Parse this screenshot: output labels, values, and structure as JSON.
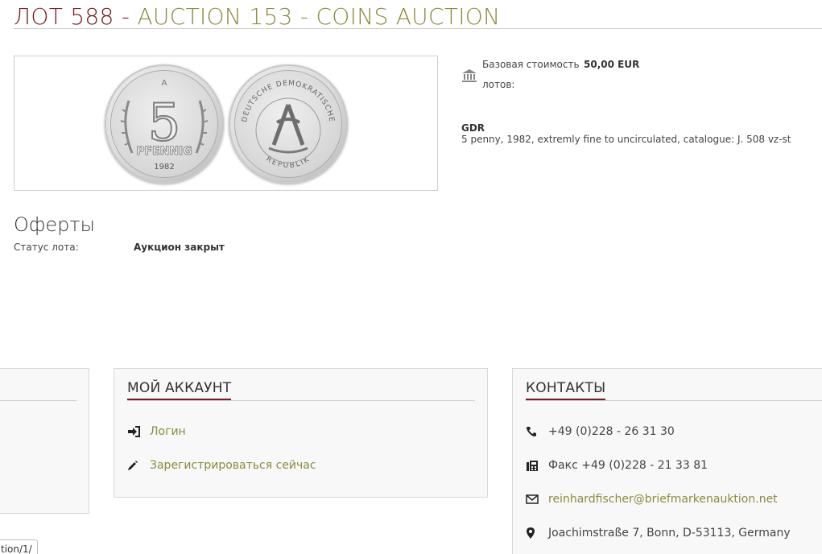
{
  "header": {
    "lot": "ЛОТ 588",
    "separator": " - ",
    "auction": "AUCTION 153 - COINS AUCTION"
  },
  "image": {
    "front_denomination": "5",
    "front_unit": "PFENNIG",
    "front_year": "1982",
    "front_mint": "A",
    "back_legend_top": "DEUTSCHE DEMOKRATISCHE",
    "back_legend_bottom": "REPUBLIK"
  },
  "details": {
    "base_label": "Базовая стоимость",
    "base_value": "50,00 EUR",
    "lots_label": "лотов:",
    "country": "GDR",
    "description": "5 penny, 1982, extremly fine to uncirculated, catalogue: J. 508 vz-st"
  },
  "offers": {
    "title": "Оферты",
    "status_label": "Статус лота:",
    "status_value": "Аукцион закрыт"
  },
  "account": {
    "heading": "МОЙ АККАУНТ",
    "login": "Логин",
    "register": "Зарегистрироваться сейчас"
  },
  "contacts": {
    "heading": "КОНТАКТЫ",
    "phone": "+49 (0)228 - 26 31 30",
    "fax": "Факс +49 (0)228 - 21 33 81",
    "email": "reinhardfischer@briefmarkenauktion.net",
    "address": "Joachimstraße 7, Bonn, D-53113, Germany"
  },
  "bottom_tab": {
    "text": "tion/1/"
  },
  "colors": {
    "lot_red": "#7a1c22",
    "olive": "#8b8b3c"
  }
}
